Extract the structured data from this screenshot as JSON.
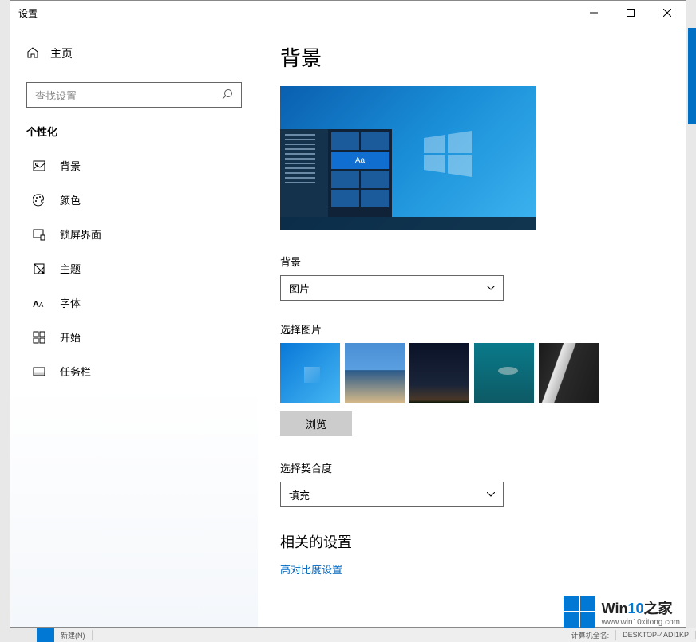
{
  "window": {
    "title": "设置"
  },
  "sidebar": {
    "home": "主页",
    "search_placeholder": "查找设置",
    "category": "个性化",
    "items": [
      {
        "label": "背景"
      },
      {
        "label": "颜色"
      },
      {
        "label": "锁屏界面"
      },
      {
        "label": "主题"
      },
      {
        "label": "字体"
      },
      {
        "label": "开始"
      },
      {
        "label": "任务栏"
      }
    ]
  },
  "main": {
    "page_title": "背景",
    "preview_sample_text": "Aa",
    "bg_label": "背景",
    "bg_select_value": "图片",
    "choose_image_label": "选择图片",
    "browse_label": "浏览",
    "fit_label": "选择契合度",
    "fit_select_value": "填充",
    "related_title": "相关的设置",
    "related_link": "高对比度设置"
  },
  "watermark": {
    "brand_prefix": "Win",
    "brand_accent": "10",
    "brand_suffix": "之家",
    "url": "www.win10xitong.com"
  },
  "background_hints": {
    "bottom_file": "新建(N)",
    "bottom_desktop": "DESKTOP-4ADI1KP",
    "bottom_label": "计算机全名:"
  }
}
